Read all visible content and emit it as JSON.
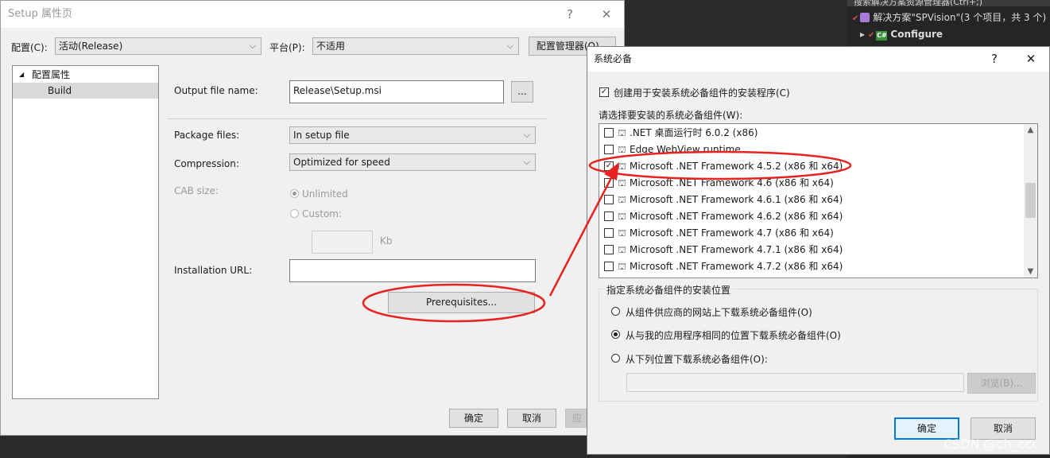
{
  "ide": {
    "search_text": "搜索解决方案资源管理器(Ctrl+;)",
    "solution_label": "解决方案\"SPVision\"(3 个项目，共 3 个)",
    "project_label": "Configure"
  },
  "prop_dialog": {
    "title": "Setup 属性页",
    "help": "?",
    "close": "✕",
    "config_label": "配置(C):",
    "config_value": "活动(Release)",
    "platform_label": "平台(P):",
    "platform_value": "不适用",
    "config_manager_btn": "配置管理器(O)...",
    "tree": {
      "root": "配置属性",
      "child": "Build",
      "expand_glyph": "◢"
    },
    "output_label": "Output file name:",
    "output_value": "Release\\Setup.msi",
    "browse_btn": "...",
    "package_label": "Package files:",
    "package_value": "In setup file",
    "compression_label": "Compression:",
    "compression_value": "Optimized for speed",
    "cab_label": "CAB size:",
    "unlimited_label": "Unlimited",
    "custom_label": "Custom:",
    "kb_label": "Kb",
    "install_url_label": "Installation URL:",
    "install_url_value": "",
    "prereq_btn": "Prerequisites...",
    "ok_btn": "确定",
    "cancel_btn": "取消",
    "apply_btn": "应"
  },
  "prereq_dialog": {
    "title": "系统必备",
    "help": "?",
    "close": "✕",
    "create_setup_label": "创建用于安装系统必备组件的安装程序(C)",
    "create_setup_checked": true,
    "choose_label": "请选择要安装的系统必备组件(W):",
    "components": [
      {
        "label": ".NET 桌面运行时 6.0.2 (x86)",
        "checked": false
      },
      {
        "label": "Edge WebView runtime",
        "checked": false
      },
      {
        "label": "Microsoft .NET Framework 4.5.2 (x86 和 x64)",
        "checked": true
      },
      {
        "label": "Microsoft .NET Framework 4.6 (x86 和 x64)",
        "checked": false
      },
      {
        "label": "Microsoft .NET Framework 4.6.1 (x86 和 x64)",
        "checked": false
      },
      {
        "label": "Microsoft .NET Framework 4.6.2 (x86 和 x64)",
        "checked": false
      },
      {
        "label": "Microsoft .NET Framework 4.7 (x86 和 x64)",
        "checked": false
      },
      {
        "label": "Microsoft .NET Framework 4.7.1 (x86 和 x64)",
        "checked": false
      },
      {
        "label": "Microsoft .NET Framework 4.7.2 (x86 和 x64)",
        "checked": false
      }
    ],
    "location_group_label": "指定系统必备组件的安装位置",
    "option_vendor": "从组件供应商的网站上下载系统必备组件(O)",
    "option_same": "从与我的应用程序相同的位置下载系统必备组件(O)",
    "option_custom": "从下列位置下载系统必备组件(O):",
    "selected_option": "same",
    "custom_location_value": "",
    "browse_btn": "浏览(B)...",
    "ok_btn": "确定",
    "cancel_btn": "取消"
  },
  "watermark": "CSDN @ch_ccc",
  "colors": {
    "annotation_red": "#e8231f",
    "accent_blue": "#0078d7"
  }
}
